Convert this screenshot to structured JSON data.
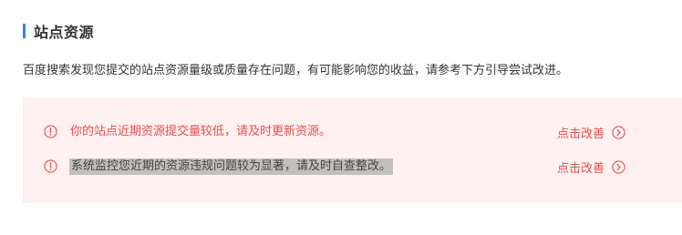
{
  "section": {
    "title": "站点资源",
    "accent_color": "#3d7ef5"
  },
  "description": "百度搜索发现您提交的站点资源量级或质量存在问题，有可能影响您的收益，请参考下方引导尝试改进。",
  "alerts": {
    "panel_color": "#fff1f1",
    "text_color": "#e8504f",
    "items": [
      {
        "icon": "warning-circle-icon",
        "message": "你的站点近期资源提交量较低，请及时更新资源。",
        "action_label": "点击改善",
        "action_icon": "chevron-right-circle-icon"
      },
      {
        "icon": "warning-circle-icon",
        "message": "系统监控您近期的资源违规问题较为显著，请及时自查整改。",
        "action_label": "点击改善",
        "action_icon": "chevron-right-circle-icon",
        "selected": true
      }
    ]
  }
}
